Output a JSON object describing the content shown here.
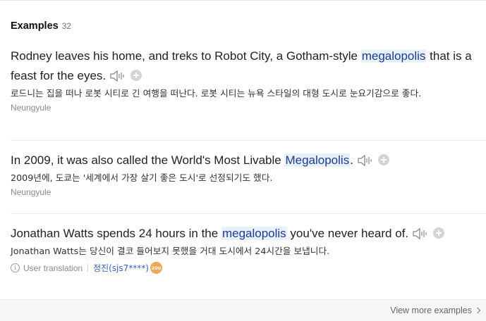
{
  "header": {
    "title": "Examples",
    "count": "32"
  },
  "examples": [
    {
      "en_before": "Rodney leaves his home, and treks to Robot City, a Gotham-style ",
      "en_highlight": "megalopolis",
      "en_after": " that is a feast for the eyes.",
      "ko": "로드니는 집을 떠나 로봇 시티로 긴 여행을 떠난다. 로봇 시티는 뉴욕 스타일의 대형 도시로 눈요기감으로 좋다.",
      "source": "Neungyule"
    },
    {
      "en_before": "In 2009, it was also called the World's Most Livable ",
      "en_highlight": "Megalopolis",
      "en_after": ".",
      "ko": "2009년에, 도쿄는 '세계에서 가장 살기 좋은 도시'로 선정되기도 했다.",
      "source": "Neungyule"
    },
    {
      "en_before": "Jonathan Watts spends 24 hours in the ",
      "en_highlight": "megalopolis",
      "en_after": " you've never heard of.",
      "ko": "Jonathan Watts는 당신이 결코 들어보지 못했을 거대 도시에서 24시간을 보냅니다.",
      "user_translation_label": "User translation",
      "user": "정진(sjs7****)",
      "user_badge": "200"
    }
  ],
  "footer": {
    "view_more": "View more examples"
  },
  "icons": {
    "audio": "speaker-icon",
    "add": "plus-circle-icon",
    "info": "info-icon",
    "chevron": "chevron-right-icon"
  },
  "colors": {
    "highlight_bg": "#e7f1fb",
    "highlight_text": "#1f3a8c",
    "link": "#3563b3",
    "badge": "#f0a55a"
  }
}
